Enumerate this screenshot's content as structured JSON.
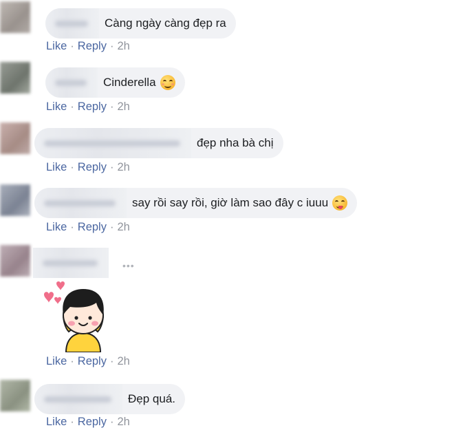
{
  "actions": {
    "like": "Like",
    "reply": "Reply",
    "sep": "·"
  },
  "comments": [
    {
      "text": "Càng ngày càng đẹp ra",
      "time": "2h",
      "emoji": null
    },
    {
      "text": "Cinderella",
      "time": "2h",
      "emoji": "smiling-face-icon"
    },
    {
      "text": "đẹp nha bà chị",
      "time": "2h",
      "emoji": null
    },
    {
      "text": "say rồi say rồi, giờ làm sao đây c iuuu",
      "time": "2h",
      "emoji": "tongue-out-face-icon"
    },
    {
      "text": "",
      "time": "2h",
      "sticker": "girl-with-hearts-sticker",
      "more_icon": "more-options-icon"
    },
    {
      "text": "Đẹp quá.",
      "time": "2h",
      "emoji": null
    }
  ],
  "colors": {
    "link": "#4b67a1",
    "bubble": "#f1f2f5",
    "meta": "#90949c"
  }
}
